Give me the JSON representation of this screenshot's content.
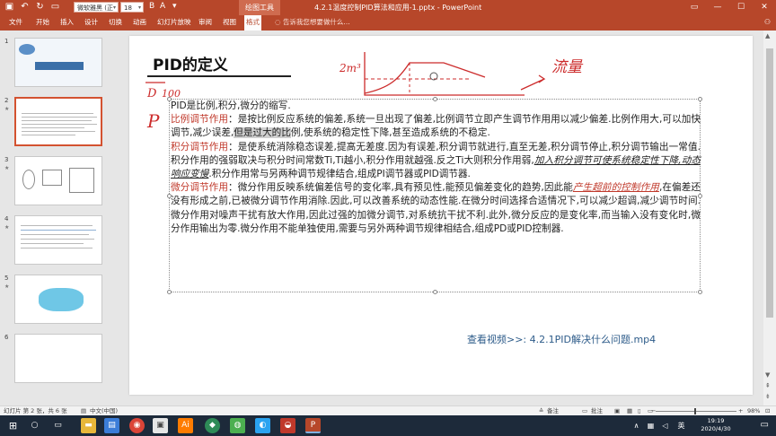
{
  "titlebar": {
    "font_name": "微软雅黑 (正文)",
    "font_size": "18",
    "context_label": "绘图工具",
    "title": "4.2.1温度控制PID算法和应用-1.pptx - PowerPoint"
  },
  "ribbon": {
    "tabs": [
      "文件",
      "开始",
      "插入",
      "设计",
      "切换",
      "动画",
      "幻灯片放映",
      "审阅",
      "视图",
      "格式"
    ],
    "tell_me": "告诉我您想要做什么..."
  },
  "thumbnails": [
    "1",
    "2",
    "3",
    "4",
    "5",
    "6"
  ],
  "slide": {
    "title": "PID的定义",
    "ink_notes": [
      "2m³",
      "流量",
      "P",
      "D",
      "100"
    ],
    "intro": "PID是比例,积分,微分的缩写.",
    "p_term": "比例调节作用",
    "p_text_1": "：是按比例反应系统的偏差,系统一旦出现了偏差,比例调节立即产生调节作用用以减少偏差.比例作用大,可以加快调节,减少误差,",
    "p_text_hl": "但是过大的比",
    "p_text_2": "例,使系统的稳定性下降,甚至造成系统的不稳定.",
    "i_term": "积分调节作用",
    "i_text_1": "：是使系统消除稳态误差,提高无差度.因为有误差,积分调节就进行,直至无差,积分调节停止,积分调节输出一常值.积分作用的强弱取决与积分时间常数Ti,Ti越小,积分作用就越强.反之Ti大则积分作用弱,",
    "i_text_em": "加入积分调节可使系统稳定性下降,动态响应变慢",
    "i_text_2": ".积分作用常与另两种调节规律结合,组成PI调节器或PID调节器.",
    "d_term": "微分调节作用",
    "d_text_1": "：微分作用反映系统偏差信号的变化率,具有预见性,能预见偏差变化的趋势,因此能",
    "d_text_em": "产生超前的控制作用",
    "d_text_2": ",在偏差还没有形成之前,已被微分调节作用消除.因此,可以改善系统的动态性能.在微分时间选择合适情况下,可以减少超调,减少调节时间.微分作用对噪声干扰有放大作用,因此过强的加微分调节,对系统抗干扰不利.此外,微分反应的是变化率,而当输入没有变化时,微分作用输出为零.微分作用不能单独使用,需要与另外两种调节规律相结合,组成PD或PID控制器.",
    "video_link": "查看视频>>: 4.2.1PID解决什么问题.mp4"
  },
  "statusbar": {
    "slide_info": "幻灯片 第 2 张，共 6 张",
    "language": "中文(中国)",
    "notes": "备注",
    "comments": "批注",
    "zoom": "98%"
  },
  "taskbar": {
    "ime": "英",
    "time": "19:19",
    "date": "2020/4/30"
  },
  "colors": {
    "accent": "#b7472a",
    "ink": "#cc2b2b",
    "term": "#c0392b",
    "link": "#2e5c8a"
  }
}
